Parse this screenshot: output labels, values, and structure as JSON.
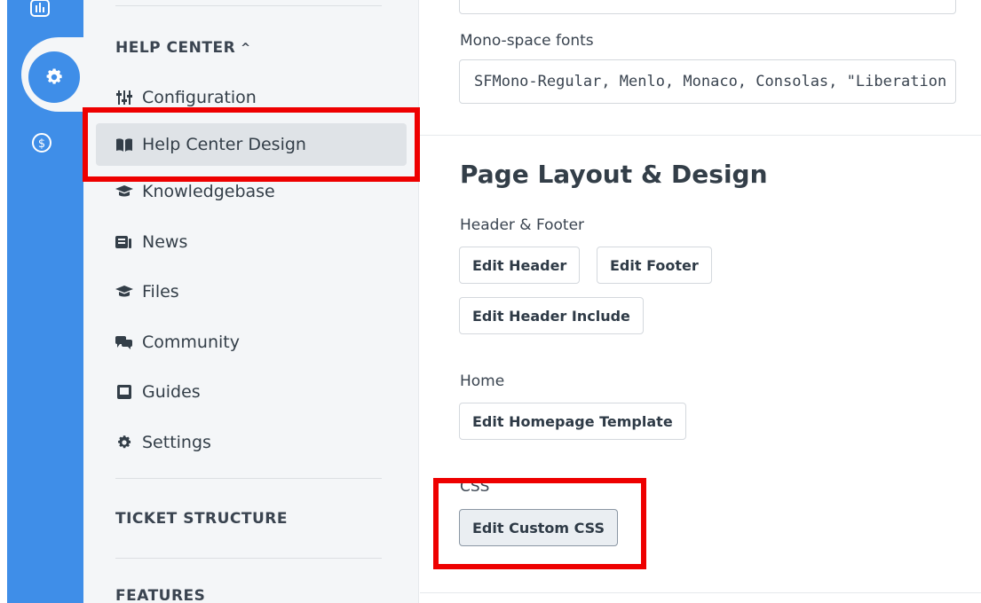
{
  "sidebar": {
    "help_center_title": "HELP CENTER",
    "help_center_chevron": "^",
    "items": [
      {
        "label": "Configuration",
        "icon": "sliders-icon"
      },
      {
        "label": "Help Center Design",
        "icon": "book-open-icon",
        "active": true
      },
      {
        "label": "Knowledgebase",
        "icon": "graduation-cap-icon"
      },
      {
        "label": "News",
        "icon": "newspaper-icon"
      },
      {
        "label": "Files",
        "icon": "graduation-cap-icon"
      },
      {
        "label": "Community",
        "icon": "comments-icon"
      },
      {
        "label": "Guides",
        "icon": "guide-book-icon"
      },
      {
        "label": "Settings",
        "icon": "gear-icon"
      }
    ],
    "ticket_structure_title": "TICKET STRUCTURE",
    "features_title": "FEATURES"
  },
  "main": {
    "mono_label": "Mono-space fonts",
    "mono_value": "SFMono-Regular, Menlo, Monaco, Consolas, \"Liberation Mono\", \"Courier New\", monospace",
    "layout_heading": "Page Layout & Design",
    "header_footer_label": "Header & Footer",
    "edit_header": "Edit Header",
    "edit_footer": "Edit Footer",
    "edit_header_include": "Edit Header Include",
    "home_label": "Home",
    "edit_homepage_template": "Edit Homepage Template",
    "css_label": "CSS",
    "edit_custom_css": "Edit Custom CSS"
  },
  "colors": {
    "rail_blue": "#3f8ee8",
    "sidebar_bg": "#f4f6f8",
    "active_item_bg": "#dfe3e7",
    "highlight_red": "#ee0000"
  }
}
